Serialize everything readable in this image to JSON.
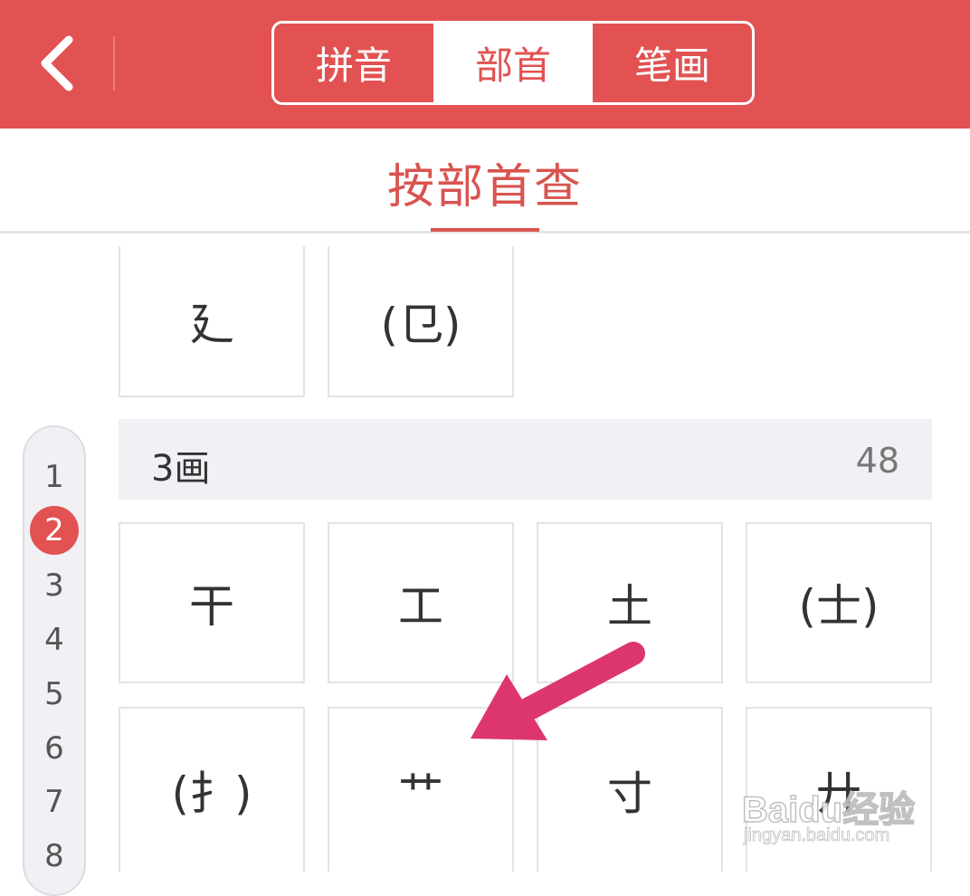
{
  "header": {
    "tabs": [
      {
        "label": "拼音",
        "active": false
      },
      {
        "label": "部首",
        "active": true
      },
      {
        "label": "笔画",
        "active": false
      }
    ],
    "accent_color": "#e25252"
  },
  "title": {
    "text": "按部首查"
  },
  "previous_section": {
    "radicals": [
      "廴",
      "(㔾)"
    ]
  },
  "section": {
    "title": "3画",
    "count": "48",
    "radicals": [
      "干",
      "工",
      "土",
      "(士)",
      "(扌)",
      "艹",
      "寸",
      "廾"
    ]
  },
  "stroke_index": {
    "items": [
      "1",
      "2",
      "3",
      "4",
      "5",
      "6",
      "7",
      "8"
    ],
    "active": "2"
  },
  "watermark": {
    "main": "Baidu经验",
    "sub": "jingyan.baidu.com"
  }
}
